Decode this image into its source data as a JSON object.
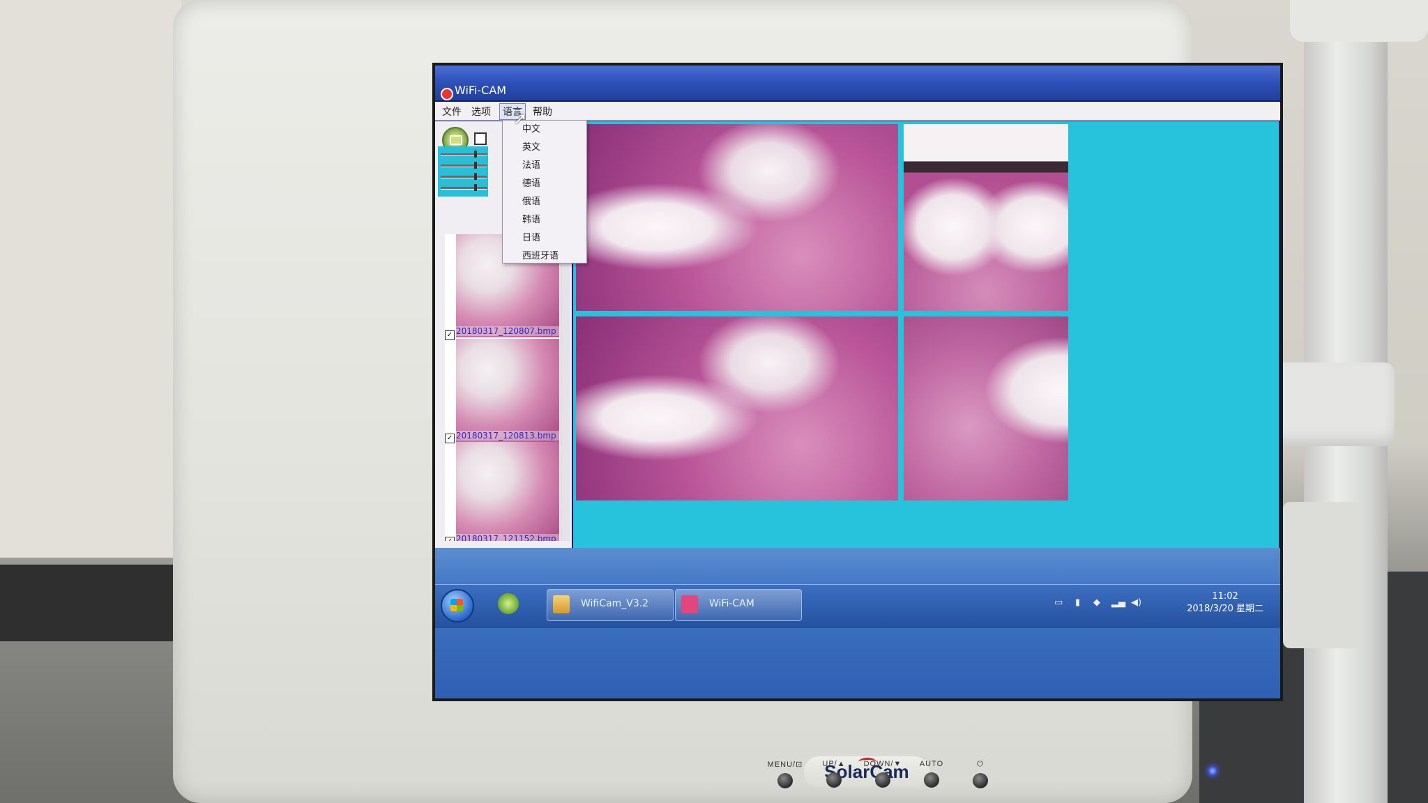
{
  "window": {
    "title": "WiFi-CAM"
  },
  "menubar": {
    "items": [
      {
        "label": "文件"
      },
      {
        "label": "选项"
      },
      {
        "label": "语言"
      },
      {
        "label": "帮助"
      }
    ],
    "open_menu": "语言"
  },
  "language_menu": {
    "items": [
      {
        "label": "中文"
      },
      {
        "label": "英文"
      },
      {
        "label": "法语"
      },
      {
        "label": "德语"
      },
      {
        "label": "俄语"
      },
      {
        "label": "韩语"
      },
      {
        "label": "日语"
      },
      {
        "label": "西班牙语"
      }
    ]
  },
  "thumbnails": [
    {
      "name": "20180317_120807.bmp",
      "checked": true
    },
    {
      "name": "20180317_120813.bmp",
      "checked": true
    },
    {
      "name": "20180317_121152.bmp",
      "checked": true
    }
  ],
  "taskbar": {
    "tasks": [
      {
        "label": "WifiCam_V3.2",
        "icon": "folder-icon"
      },
      {
        "label": "WiFi-CAM",
        "icon": "camera-app-icon"
      }
    ],
    "clock": {
      "time": "11:02",
      "date": "2018/3/20 星期二"
    }
  },
  "monitor": {
    "brand": "SolarCam",
    "buttons": [
      {
        "label": "MENU/⊡"
      },
      {
        "label": "UP/▲"
      },
      {
        "label": "DOWN/▼"
      },
      {
        "label": "AUTO"
      },
      {
        "label": "⏻"
      }
    ]
  },
  "colors": {
    "viewer_frame": "#27c2dc",
    "titlebar": "#2d4fb8",
    "taskbar": "#3f74c4",
    "thumb_label": "#2a2ad0"
  }
}
